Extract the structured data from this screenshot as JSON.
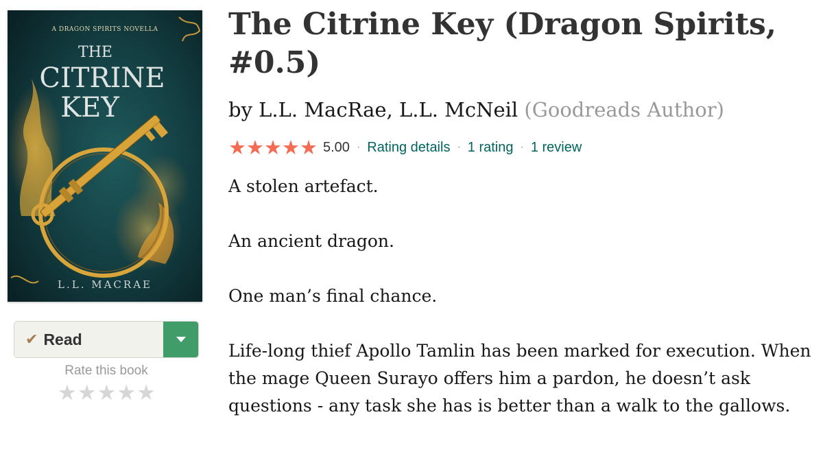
{
  "book": {
    "title": "The Citrine Key (Dragon Spirits, #0.5)",
    "author_prefix": "by",
    "authors": [
      "L.L. MacRae",
      "L.L. McNeil"
    ],
    "author_separator": ",",
    "author_badge": "(Goodreads Author)"
  },
  "cover": {
    "series_line": "A DRAGON SPIRITS NOVELLA",
    "title_lines": [
      "THE",
      "CITRINE",
      "KEY"
    ],
    "author": "L.L. MACRAE",
    "colors": {
      "bg": "#123b3f",
      "gold": "#d9a53a",
      "flame": "#f6c244"
    }
  },
  "shelf": {
    "status_label": "Read",
    "check_icon": "checkmark-icon",
    "dropdown_icon": "caret-down-icon",
    "rate_label": "Rate this book",
    "user_rating": 0,
    "max_stars": 5
  },
  "rating": {
    "stars_filled": 5,
    "average": "5.00",
    "separator": "·",
    "details_link": "Rating details",
    "ratings_count": "1 rating",
    "reviews_count": "1 review",
    "star_color": "#f36c54"
  },
  "description": {
    "paragraphs": [
      "A stolen artefact.",
      "An ancient dragon.",
      "One man’s final chance.",
      "Life-long thief Apollo Tamlin has been marked for execution. When the mage Queen Surayo offers him a pardon, he doesn’t ask questions - any task she has is better than a walk to the gallows."
    ]
  },
  "colors": {
    "link": "#00635d",
    "button_green": "#409d69",
    "button_bg": "#f2f2ec"
  }
}
